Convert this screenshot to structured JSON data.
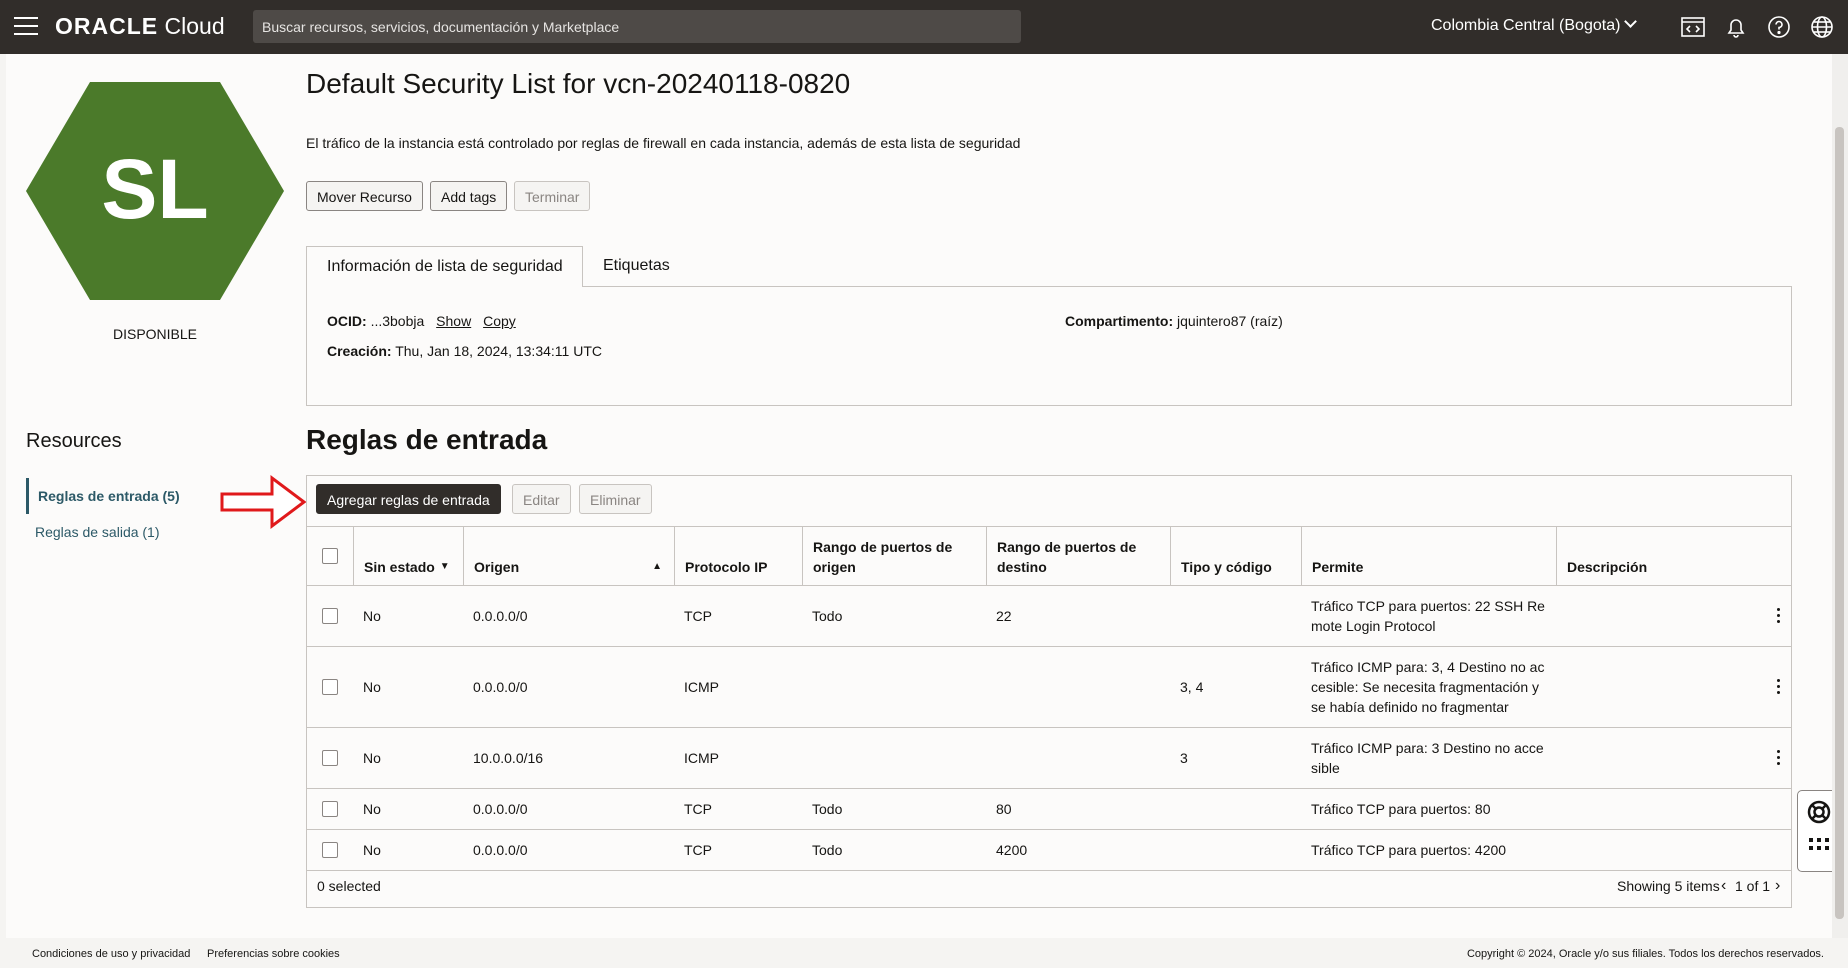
{
  "topbar": {
    "logo_brand": "ORACLE",
    "logo_product": "Cloud",
    "search_placeholder": "Buscar recursos, servicios, documentación y Marketplace",
    "region": "Colombia Central (Bogota)",
    "icons": [
      "code-editor-icon",
      "bell-icon",
      "help-icon",
      "globe-icon",
      "user-icon"
    ]
  },
  "resource": {
    "initials": "SL",
    "status": "DISPONIBLE",
    "hex_color": "#4b7a2a",
    "title": "Default Security List for vcn-20240118-0820",
    "description": "El tráfico de la instancia está controlado por reglas de firewall en cada instancia, además de esta lista de seguridad",
    "buttons": {
      "move": "Mover Recurso",
      "tags": "Add tags",
      "terminate": "Terminar"
    }
  },
  "tabs": {
    "info": "Información de lista de seguridad",
    "labels": "Etiquetas"
  },
  "info": {
    "ocid_label": "OCID:",
    "ocid_value": "...3bobja",
    "show": "Show",
    "copy": "Copy",
    "created_label": "Creación:",
    "created_value": "Thu, Jan 18, 2024, 13:34:11 UTC",
    "compartment_label": "Compartimento:",
    "compartment_value": "jquintero87 (raíz)"
  },
  "resources": {
    "title": "Resources",
    "items": [
      {
        "label": "Reglas de entrada (5)",
        "active": true
      },
      {
        "label": "Reglas de salida (1)",
        "active": false
      }
    ]
  },
  "ingress": {
    "title": "Reglas de entrada",
    "buttons": {
      "add": "Agregar reglas de entrada",
      "edit": "Editar",
      "delete": "Eliminar"
    },
    "columns": {
      "stateless": "Sin estado",
      "source": "Origen",
      "protocol": "Protocolo IP",
      "src_port": "Rango de puertos de origen",
      "dst_port": "Rango de puertos de destino",
      "type_code": "Tipo y código",
      "allows": "Permite",
      "description": "Descripción"
    },
    "rows": [
      {
        "stateless": "No",
        "source": "0.0.0.0/0",
        "protocol": "TCP",
        "src_port": "Todo",
        "dst_port": "22",
        "type_code": "",
        "allows": "Tráfico TCP para puertos: 22 SSH Remote Login Protocol",
        "description": ""
      },
      {
        "stateless": "No",
        "source": "0.0.0.0/0",
        "protocol": "ICMP",
        "src_port": "",
        "dst_port": "",
        "type_code": "3, 4",
        "allows": "Tráfico ICMP para: 3, 4 Destino no accesible: Se necesita fragmentación y se había definido no fragmentar",
        "description": ""
      },
      {
        "stateless": "No",
        "source": "10.0.0.0/16",
        "protocol": "ICMP",
        "src_port": "",
        "dst_port": "",
        "type_code": "3",
        "allows": "Tráfico ICMP para: 3 Destino no accesible",
        "description": ""
      },
      {
        "stateless": "No",
        "source": "0.0.0.0/0",
        "protocol": "TCP",
        "src_port": "Todo",
        "dst_port": "80",
        "type_code": "",
        "allows": "Tráfico TCP para puertos: 80",
        "description": ""
      },
      {
        "stateless": "No",
        "source": "0.0.0.0/0",
        "protocol": "TCP",
        "src_port": "Todo",
        "dst_port": "4200",
        "type_code": "",
        "allows": "Tráfico TCP para puertos: 4200",
        "description": ""
      }
    ],
    "selected": "0 selected",
    "showing": "Showing 5 items",
    "pagination": "1 of 1"
  },
  "footer": {
    "terms": "Condiciones de uso y privacidad",
    "cookies": "Preferencias sobre cookies",
    "copyright": "Copyright © 2024, Oracle y/o sus filiales. Todos los derechos reservados."
  }
}
